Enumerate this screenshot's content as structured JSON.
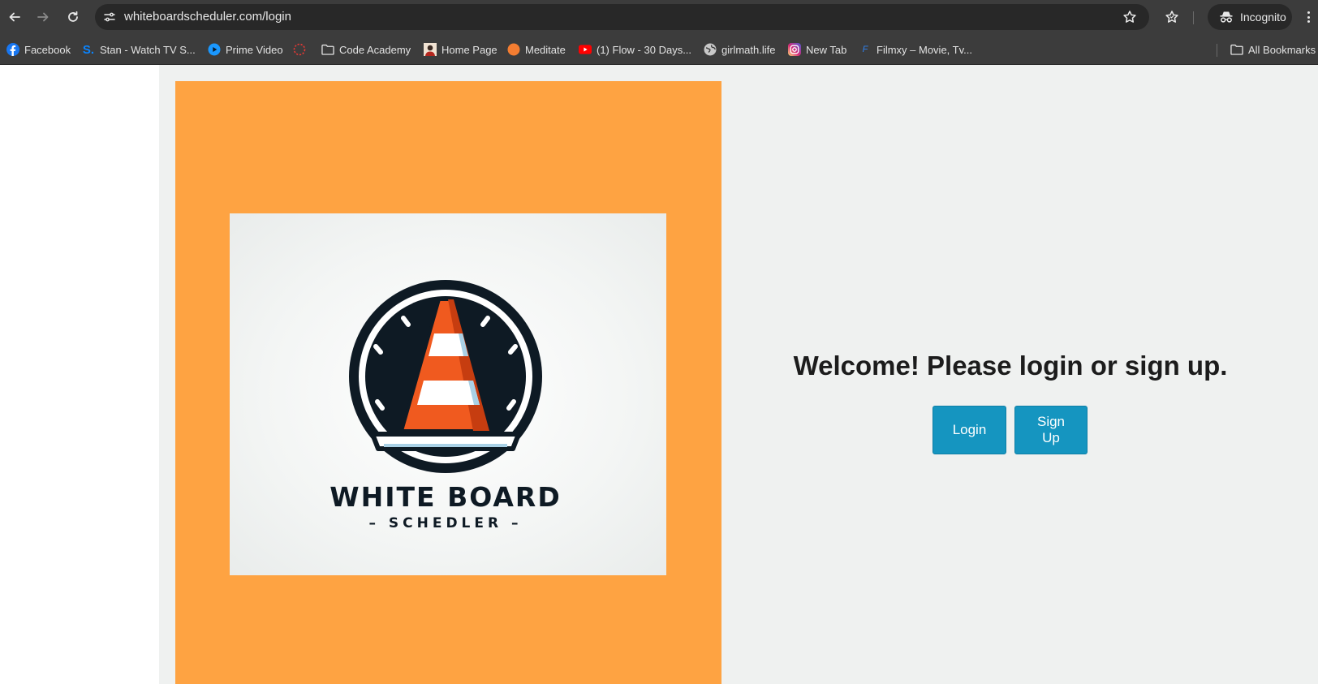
{
  "browser": {
    "url": "whiteboardscheduler.com/login",
    "incognito_label": "Incognito",
    "bookmarks": [
      {
        "label": "Facebook",
        "icon": "facebook-icon"
      },
      {
        "label": "Stan - Watch TV S...",
        "icon": "stan-icon"
      },
      {
        "label": "Prime Video",
        "icon": "prime-video-icon"
      },
      {
        "label": "",
        "icon": "loading-circle-icon"
      },
      {
        "label": "Code Academy",
        "icon": "folder-icon"
      },
      {
        "label": "Home Page",
        "icon": "avatar-icon"
      },
      {
        "label": "Meditate",
        "icon": "orange-dot-icon"
      },
      {
        "label": "(1) Flow - 30 Days...",
        "icon": "youtube-icon"
      },
      {
        "label": "girlmath.life",
        "icon": "globe-icon"
      },
      {
        "label": "New Tab",
        "icon": "instagram-icon"
      },
      {
        "label": "Filmxy – Movie, Tv...",
        "icon": "filmxy-icon"
      }
    ],
    "all_bookmarks_label": "All Bookmarks"
  },
  "logo": {
    "title": "WHITE BOARD",
    "subtitle": "– SCHEDLER –"
  },
  "main": {
    "welcome": "Welcome! Please login or sign up.",
    "login_label": "Login",
    "signup_label": "Sign Up"
  },
  "colors": {
    "orange_panel": "#fea342",
    "button": "#1595c0",
    "chrome": "#3c3c3c"
  }
}
